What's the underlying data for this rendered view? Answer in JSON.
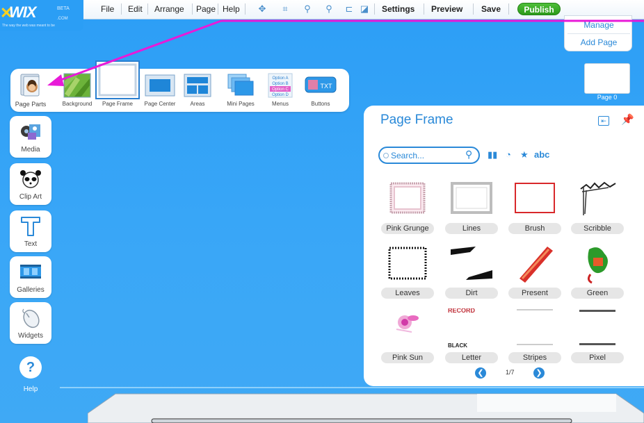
{
  "logo": {
    "wordmark": "WIX",
    "beta": "BETA",
    "com": ".COM",
    "tagline": "The way the web was meant to be"
  },
  "menu": {
    "file": "File",
    "edit": "Edit",
    "arrange": "Arrange",
    "page": "Page",
    "help": "Help",
    "settings": "Settings",
    "preview": "Preview",
    "save": "Save",
    "publish": "Publish"
  },
  "toolbar_icons": [
    "move-icon",
    "fit-icon",
    "zoom-in-icon",
    "zoom-out-icon",
    "ruler-icon",
    "eraser-icon"
  ],
  "pages_panel": {
    "manage": "Manage",
    "add_page": "Add Page",
    "page_label": "Page 0"
  },
  "page_parts": {
    "items": [
      {
        "label": "Page Parts"
      },
      {
        "label": "Background"
      },
      {
        "label": "Page Frame"
      },
      {
        "label": "Page Center"
      },
      {
        "label": "Areas"
      },
      {
        "label": "Mini Pages"
      },
      {
        "label": "Menus"
      },
      {
        "label": "Buttons"
      }
    ],
    "menu_options": [
      "Option A",
      "Option B",
      "Option C",
      "Option D"
    ],
    "button_thumb_text": "TXT"
  },
  "side_tools": [
    {
      "label": "Media"
    },
    {
      "label": "Clip Art"
    },
    {
      "label": "Text"
    },
    {
      "label": "Galleries"
    },
    {
      "label": "Widgets"
    }
  ],
  "help": {
    "label": "Help",
    "symbol": "?"
  },
  "page_frame_panel": {
    "title": "Page Frame",
    "search_placeholder": "Search...",
    "sort_abc": "abc",
    "frames": [
      {
        "label": "Pink Grunge"
      },
      {
        "label": "Lines"
      },
      {
        "label": "Brush"
      },
      {
        "label": "Scribble"
      },
      {
        "label": "Leaves"
      },
      {
        "label": "Dirt"
      },
      {
        "label": "Present"
      },
      {
        "label": "Green"
      },
      {
        "label": "Pink Sun"
      },
      {
        "label": "Letter"
      },
      {
        "label": "Stripes"
      },
      {
        "label": "Pixel"
      }
    ],
    "letter_thumb_top": "RECORD",
    "letter_thumb_bottom": "BLACK",
    "pager": "1/7"
  },
  "colors": {
    "canvas": "#3aa7f7",
    "accent": "#2a89d8",
    "publish": "#2c9a1a",
    "annotation": "#e81ad8"
  }
}
